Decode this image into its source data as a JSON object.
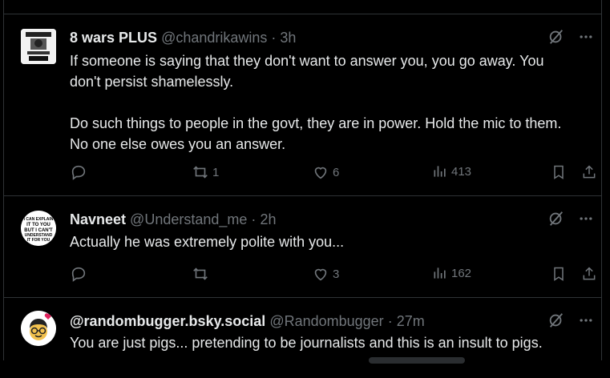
{
  "tweets": [
    {
      "name": "8 wars PLUS",
      "handle": "@chandrikawins",
      "sep": "·",
      "time": "3h",
      "text": "If someone is saying that they don't want to answer you, you go away. You don't persist shamelessly.\n\nDo such things to people in the govt, they are in power. Hold the mic to them. No one else owes you an answer.",
      "retweets": "1",
      "likes": "6",
      "views": "413"
    },
    {
      "name": "Navneet",
      "handle": "@Understand_me",
      "sep": "·",
      "time": "2h",
      "text": "Actually he was extremely polite with you...",
      "retweets": "",
      "likes": "3",
      "views": "162",
      "avatar_text": [
        "I CAN EXPLAIN",
        "IT TO YOU",
        "BUT I CAN'T",
        "UNDERSTAND",
        "IT FOR YOU"
      ]
    },
    {
      "name": "@randombugger.bsky.social",
      "handle": "@Randombugger",
      "sep": "·",
      "time": "27m",
      "text": "You are just pigs... pretending to be journalists and this is an insult to pigs."
    }
  ],
  "icons": {
    "grok": "grok-icon",
    "more": "more-icon",
    "reply": "reply-icon",
    "retweet": "retweet-icon",
    "like": "like-icon",
    "views": "views-icon",
    "bookmark": "bookmark-icon",
    "share": "share-icon"
  },
  "colors": {
    "background": "#000000",
    "text": "#e7e9ea",
    "muted": "#71767b",
    "border": "#2f3336"
  }
}
